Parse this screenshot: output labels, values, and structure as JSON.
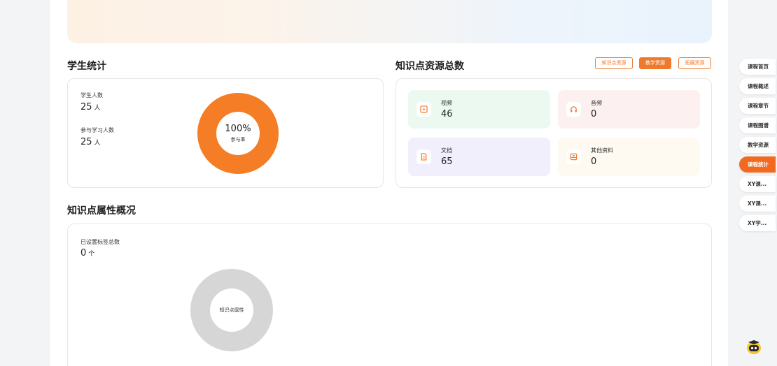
{
  "student_stats": {
    "title": "学生统计",
    "total_label": "学生人数",
    "total_value": "25",
    "total_unit": "人",
    "participant_label": "参与学习人数",
    "participant_value": "25",
    "participant_unit": "人",
    "ring_value": "100%",
    "ring_label": "参与率",
    "ring_color": "#f47d26",
    "participation_fraction": 1.0
  },
  "resources": {
    "title": "知识点资源总数",
    "buttons": [
      {
        "label": "知识点资源",
        "active": false
      },
      {
        "label": "教学资源",
        "active": true
      },
      {
        "label": "拓展资源",
        "active": false
      }
    ],
    "tiles": [
      {
        "name": "视频",
        "count": "46",
        "icon": "video-play-icon",
        "bg": "#ebf9f1",
        "icon_color": "#f07a2c"
      },
      {
        "name": "音频",
        "count": "0",
        "icon": "headphones-icon",
        "bg": "#fdf0f0",
        "icon_color": "#f07a2c"
      },
      {
        "name": "文档",
        "count": "65",
        "icon": "document-icon",
        "bg": "#f1effc",
        "icon_color": "#f07a2c"
      },
      {
        "name": "其他资料",
        "count": "0",
        "icon": "archive-icon",
        "bg": "#fefaf2",
        "icon_color": "#f07a2c"
      }
    ]
  },
  "knowledge_attrs": {
    "title": "知识点属性概况",
    "tag_label": "已设置标签总数",
    "tag_value": "0",
    "tag_unit": "个",
    "ring_label": "知识点属性",
    "ring_color": "#d6d6d6"
  },
  "side_nav": {
    "items": [
      {
        "label": "课程首页",
        "active": false
      },
      {
        "label": "课程概述",
        "active": false
      },
      {
        "label": "课程章节",
        "active": false
      },
      {
        "label": "课程图谱",
        "active": false
      },
      {
        "label": "教学资源",
        "active": false
      },
      {
        "label": "课程统计",
        "active": true
      },
      {
        "label": "XY课...",
        "active": false
      },
      {
        "label": "XY课...",
        "active": false
      },
      {
        "label": "XY学...",
        "active": false
      }
    ]
  },
  "assistant": {
    "icon": "robot-assistant-icon"
  }
}
